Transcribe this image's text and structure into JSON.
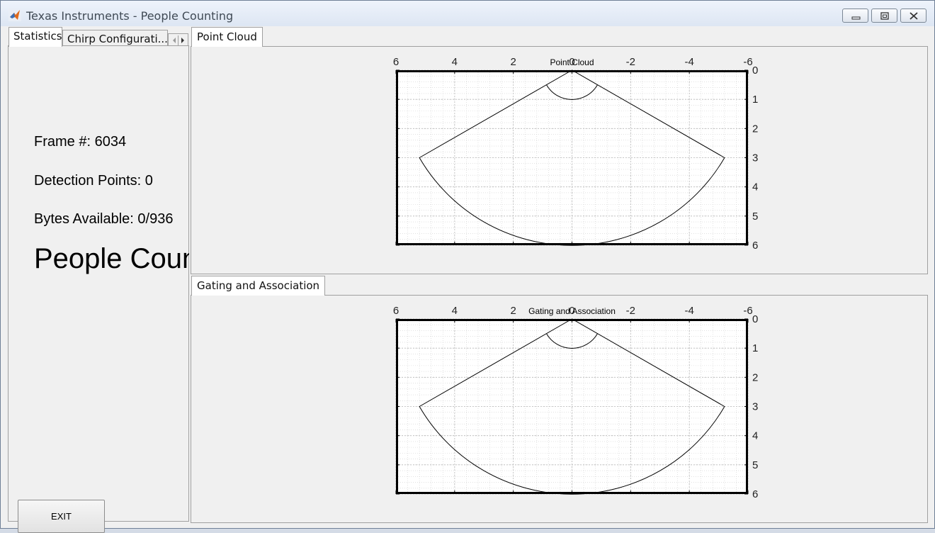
{
  "window": {
    "title": "Texas Instruments - People Counting",
    "buttons": [
      "minimize-icon",
      "restore-icon",
      "close-icon"
    ]
  },
  "left_tabs": [
    {
      "label": "Statistics",
      "active": true
    },
    {
      "label": "Chirp Configurati...",
      "active": false
    }
  ],
  "stats": {
    "frame": "Frame #: 6034",
    "detection_points": "Detection Points: 0",
    "bytes_available": "Bytes Available: 0/936",
    "people_count": "People Count"
  },
  "exit_label": "EXIT",
  "panels": [
    {
      "tab": "Point Cloud"
    },
    {
      "tab": "Gating and Association"
    }
  ],
  "chart_data": [
    {
      "type": "line",
      "title": "Point Cloud",
      "xlabel": "",
      "ylabel": "",
      "xlim": [
        6,
        -6
      ],
      "ylim": [
        6,
        0
      ],
      "x_ticks": [
        "6",
        "4",
        "2",
        "0",
        "-2",
        "-4",
        "-6"
      ],
      "y_ticks": [
        "0",
        "1",
        "2",
        "3",
        "4",
        "5",
        "6"
      ],
      "x_axis_location": "top",
      "y_axis_location": "right",
      "grid": true,
      "minor_grid": true,
      "series": [
        {
          "points": [
            [
              0,
              0
            ],
            [
              5.2,
              3
            ],
            [
              3,
              5.2
            ],
            [
              0,
              6
            ],
            [
              -3,
              5.2
            ],
            [
              -5.2,
              3
            ],
            [
              0,
              0
            ]
          ]
        },
        {
          "points": [
            [
              0.87,
              0.5
            ],
            [
              0.5,
              0.87
            ],
            [
              0,
              1
            ],
            [
              -0.5,
              0.87
            ],
            [
              -0.87,
              0.5
            ]
          ]
        }
      ]
    },
    {
      "type": "line",
      "title": "Gating and Association",
      "xlabel": "",
      "ylabel": "",
      "xlim": [
        6,
        -6
      ],
      "ylim": [
        6,
        0
      ],
      "x_ticks": [
        "6",
        "4",
        "2",
        "0",
        "-2",
        "-4",
        "-6"
      ],
      "y_ticks": [
        "0",
        "1",
        "2",
        "3",
        "4",
        "5",
        "6"
      ],
      "x_axis_location": "top",
      "y_axis_location": "right",
      "grid": true,
      "minor_grid": true,
      "series": [
        {
          "points": [
            [
              0,
              0
            ],
            [
              5.2,
              3
            ],
            [
              3,
              5.2
            ],
            [
              0,
              6
            ],
            [
              -3,
              5.2
            ],
            [
              -5.2,
              3
            ],
            [
              0,
              0
            ]
          ]
        },
        {
          "points": [
            [
              0.87,
              0.5
            ],
            [
              0.5,
              0.87
            ],
            [
              0,
              1
            ],
            [
              -0.5,
              0.87
            ],
            [
              -0.87,
              0.5
            ]
          ]
        }
      ]
    }
  ]
}
